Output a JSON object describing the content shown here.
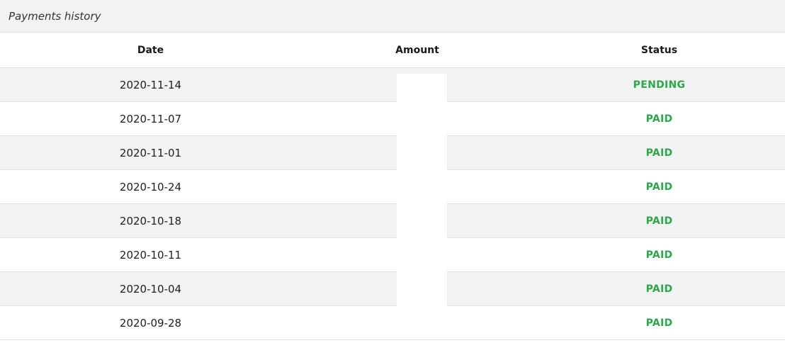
{
  "panel": {
    "title": "Payments history"
  },
  "table": {
    "columns": [
      "Date",
      "Amount",
      "Status"
    ],
    "rows": [
      {
        "date": "2020-11-14",
        "amount": "",
        "status": "PENDING"
      },
      {
        "date": "2020-11-07",
        "amount": "",
        "status": "PAID"
      },
      {
        "date": "2020-11-01",
        "amount": "",
        "status": "PAID"
      },
      {
        "date": "2020-10-24",
        "amount": "",
        "status": "PAID"
      },
      {
        "date": "2020-10-18",
        "amount": "",
        "status": "PAID"
      },
      {
        "date": "2020-10-11",
        "amount": "",
        "status": "PAID"
      },
      {
        "date": "2020-10-04",
        "amount": "",
        "status": "PAID"
      },
      {
        "date": "2020-09-28",
        "amount": "",
        "status": "PAID"
      }
    ]
  },
  "colors": {
    "status_text": "#2aa84a",
    "row_stripe": "#f2f2f2",
    "header_bg": "#f2f2f2"
  }
}
